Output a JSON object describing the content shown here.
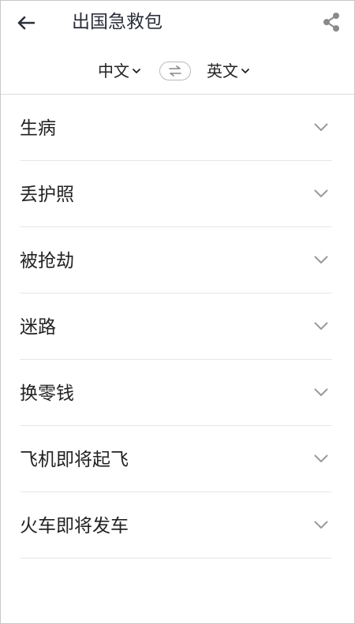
{
  "header": {
    "title": "出国急救包",
    "back_icon": "back-arrow-icon",
    "share_icon": "share-icon"
  },
  "languages": {
    "source": "中文",
    "target": "英文",
    "swap_icon": "swap-icon"
  },
  "categories": [
    {
      "label": "生病"
    },
    {
      "label": "丢护照"
    },
    {
      "label": "被抢劫"
    },
    {
      "label": "迷路"
    },
    {
      "label": "换零钱"
    },
    {
      "label": "飞机即将起飞"
    },
    {
      "label": "火车即将发车"
    }
  ],
  "colors": {
    "title": "#2b2f3a",
    "text": "#222222",
    "chevron": "#9a9a9a",
    "divider": "#e6e6e6"
  }
}
